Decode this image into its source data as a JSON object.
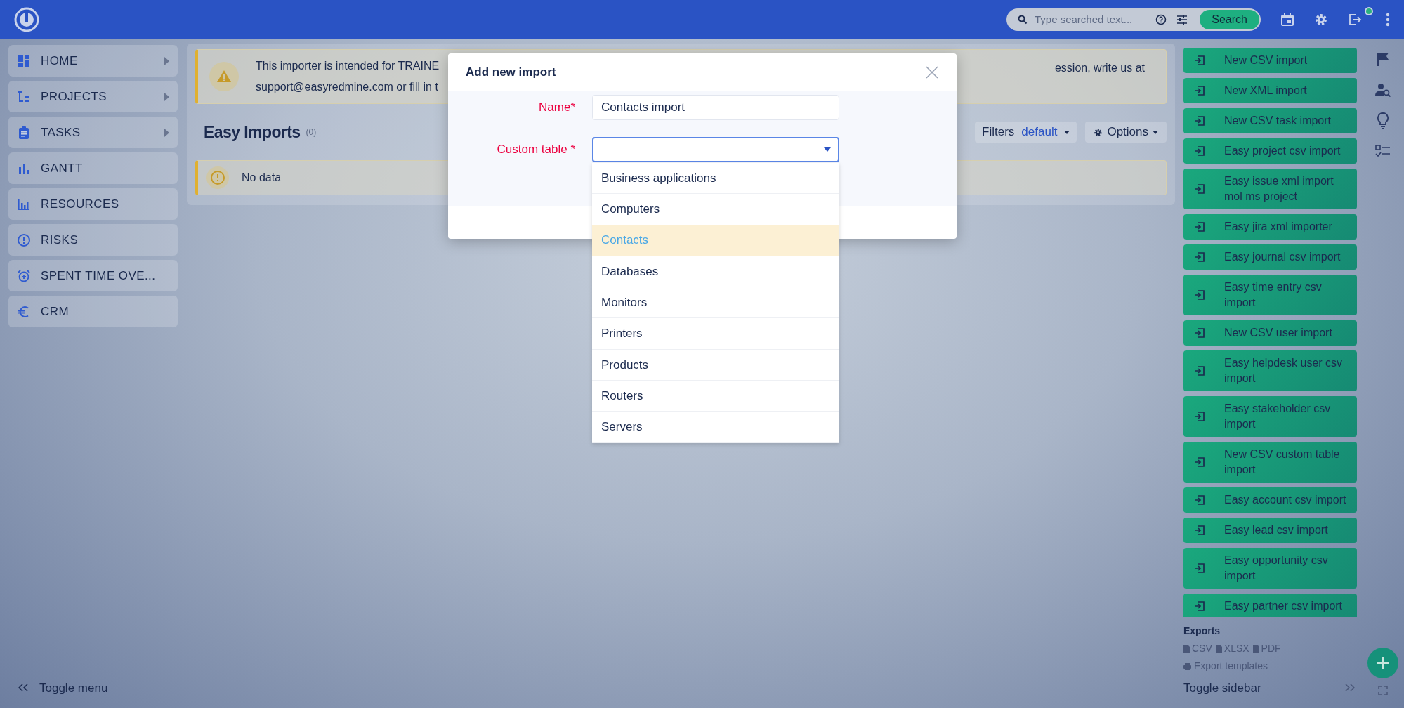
{
  "header": {
    "search": {
      "placeholder": "Type searched text...",
      "button": "Search"
    },
    "notification_dot": true
  },
  "sidebar": {
    "items": [
      {
        "label": "HOME",
        "has_submenu": true
      },
      {
        "label": "PROJECTS",
        "has_submenu": true
      },
      {
        "label": "TASKS",
        "has_submenu": true
      },
      {
        "label": "GANTT",
        "has_submenu": false
      },
      {
        "label": "RESOURCES",
        "has_submenu": false
      },
      {
        "label": "RISKS",
        "has_submenu": false
      },
      {
        "label": "SPENT TIME OVE...",
        "has_submenu": false
      },
      {
        "label": "CRM",
        "has_submenu": false
      }
    ],
    "toggle": "Toggle menu"
  },
  "notice": {
    "line_1_start": "This importer is intended for TRAINE",
    "line_1_end": "ession, write us at",
    "line_2_start": "support@easyredmine.com or fill in t"
  },
  "list": {
    "title": "Easy Imports",
    "count": "(0)",
    "filters_label": "Filters",
    "filters_value": "default",
    "options": "Options",
    "empty": "No data"
  },
  "modal": {
    "title": "Add new import",
    "name_label": "Name*",
    "name_value": "Contacts import",
    "table_label": "Custom table *",
    "options": [
      {
        "label": "Business applications",
        "selected": false
      },
      {
        "label": "Computers",
        "selected": false
      },
      {
        "label": "Contacts",
        "selected": true
      },
      {
        "label": "Databases",
        "selected": false
      },
      {
        "label": "Monitors",
        "selected": false
      },
      {
        "label": "Printers",
        "selected": false
      },
      {
        "label": "Products",
        "selected": false
      },
      {
        "label": "Routers",
        "selected": false
      },
      {
        "label": "Servers",
        "selected": false
      }
    ]
  },
  "right_sidebar": {
    "actions": [
      "New CSV import",
      "New XML import",
      "New CSV task import",
      "Easy project csv import",
      "Easy issue xml import mol ms project",
      "Easy jira xml importer",
      "Easy journal csv import",
      "Easy time entry csv import",
      "New CSV user import",
      "Easy helpdesk user csv import",
      "Easy stakeholder csv import",
      "New CSV custom table import",
      "Easy account csv import",
      "Easy lead csv import",
      "Easy opportunity csv import",
      "Easy partner csv import"
    ],
    "exports_title": "Exports",
    "formats": [
      "CSV",
      "XLSX",
      "PDF"
    ],
    "templates": "Export templates",
    "toggle": "Toggle sidebar"
  }
}
